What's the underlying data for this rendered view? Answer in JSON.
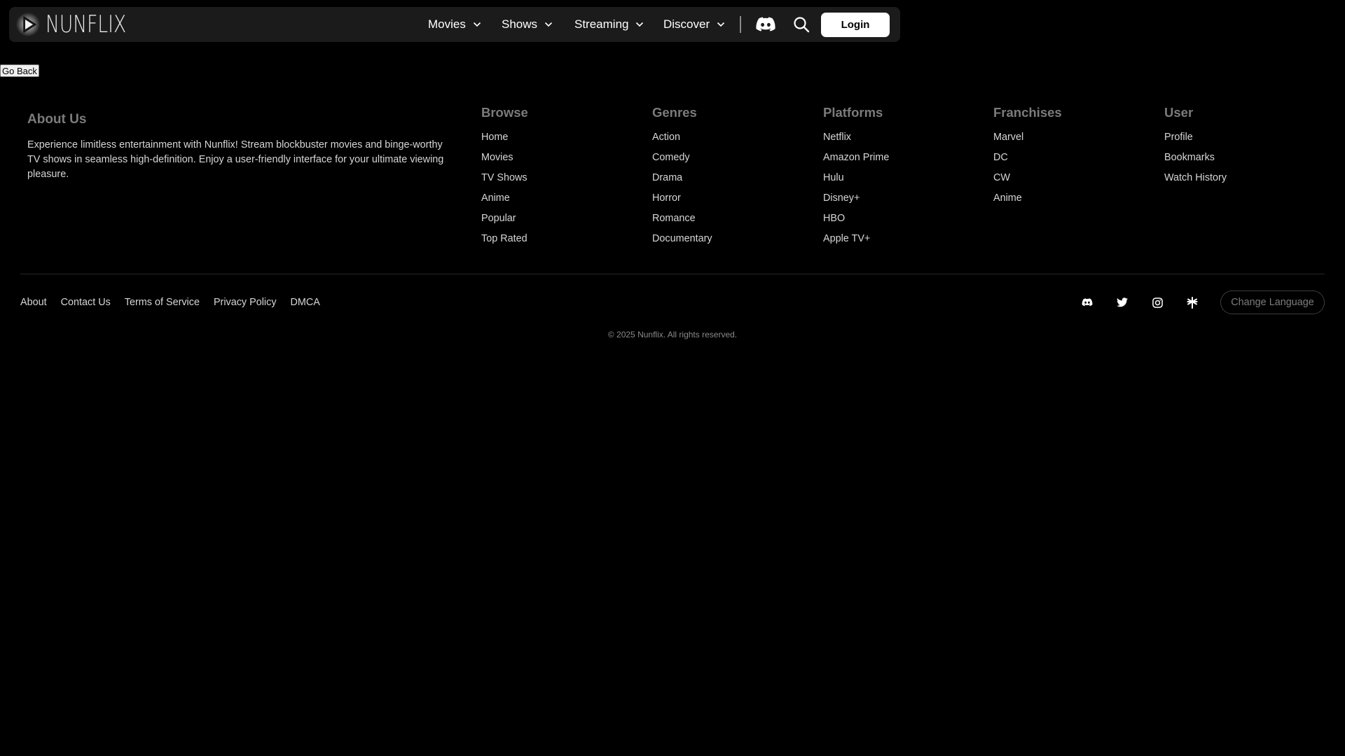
{
  "brand": {
    "name": "NUNFLIX"
  },
  "nav": {
    "items": [
      {
        "label": "Movies"
      },
      {
        "label": "Shows"
      },
      {
        "label": "Streaming"
      },
      {
        "label": "Discover"
      }
    ],
    "icons": [
      "discord-icon",
      "search-icon"
    ],
    "login_label": "Login"
  },
  "go_back_label": "Go Back",
  "footer": {
    "about": {
      "heading": "About Us",
      "text": "Experience limitless entertainment with Nunflix! Stream blockbuster movies and binge-worthy TV shows in seamless high-definition. Enjoy a user-friendly interface for your ultimate viewing pleasure."
    },
    "columns": [
      {
        "heading": "Browse",
        "links": [
          "Home",
          "Movies",
          "TV Shows",
          "Anime",
          "Popular",
          "Top Rated"
        ]
      },
      {
        "heading": "Genres",
        "links": [
          "Action",
          "Comedy",
          "Drama",
          "Horror",
          "Romance",
          "Documentary"
        ]
      },
      {
        "heading": "Platforms",
        "links": [
          "Netflix",
          "Amazon Prime",
          "Hulu",
          "Disney+",
          "HBO",
          "Apple TV+"
        ]
      },
      {
        "heading": "Franchises",
        "links": [
          "Marvel",
          "DC",
          "CW",
          "Anime"
        ]
      },
      {
        "heading": "User",
        "links": [
          "Profile",
          "Bookmarks",
          "Watch History"
        ]
      }
    ],
    "bottom_links": [
      "About",
      "Contact Us",
      "Terms of Service",
      "Privacy Policy",
      "DMCA"
    ],
    "social_icons": [
      "discord-icon",
      "twitter-icon",
      "instagram-icon",
      "linktree-icon"
    ],
    "change_language_label": "Change Language",
    "copyright": "© 2025 Nunflix. All rights reserved."
  },
  "colors": {
    "background": "#000000",
    "navbar": "#1b1b1b",
    "heading_muted": "#7b7b7b",
    "link_text": "#d6d6d6",
    "login_bg": "#ffffff"
  }
}
